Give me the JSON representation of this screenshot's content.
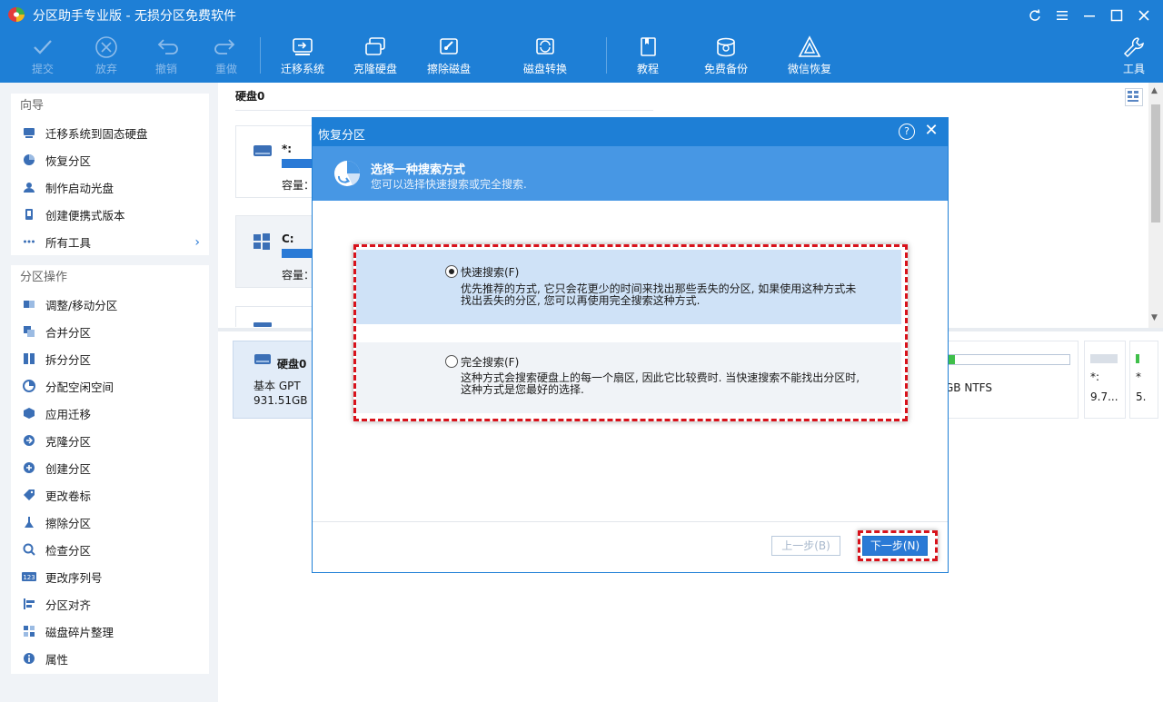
{
  "window": {
    "title": "分区助手专业版 - 无损分区免费软件",
    "controls": [
      "refresh-icon",
      "menu-icon",
      "minimize-icon",
      "maximize-icon",
      "close-icon"
    ]
  },
  "toolbar": {
    "commit": "提交",
    "discard": "放弃",
    "undo": "撤销",
    "redo": "重做",
    "migrate_os": "迁移系统",
    "clone_disk": "克隆硬盘",
    "wipe_disk": "擦除磁盘",
    "disk_convert": "磁盘转换",
    "tutorial": "教程",
    "free_backup": "免费备份",
    "wechat_recovery": "微信恢复",
    "tools": "工具"
  },
  "sidebar": {
    "wizard_header": "向导",
    "wizard_items": [
      {
        "label": "迁移系统到固态硬盘",
        "icon": "migrate-ssd-icon"
      },
      {
        "label": "恢复分区",
        "icon": "recover-partition-icon"
      },
      {
        "label": "制作启动光盘",
        "icon": "bootable-media-icon"
      },
      {
        "label": "创建便携式版本",
        "icon": "portable-version-icon"
      },
      {
        "label": "所有工具",
        "icon": "all-tools-icon"
      }
    ],
    "ops_header": "分区操作",
    "ops_items": [
      {
        "label": "调整/移动分区",
        "icon": "resize-partition-icon"
      },
      {
        "label": "合并分区",
        "icon": "merge-partition-icon"
      },
      {
        "label": "拆分分区",
        "icon": "split-partition-icon"
      },
      {
        "label": "分配空闲空间",
        "icon": "allocate-space-icon"
      },
      {
        "label": "应用迁移",
        "icon": "app-migrate-icon"
      },
      {
        "label": "克隆分区",
        "icon": "clone-partition-icon"
      },
      {
        "label": "创建分区",
        "icon": "create-partition-icon"
      },
      {
        "label": "更改卷标",
        "icon": "change-label-icon"
      },
      {
        "label": "擦除分区",
        "icon": "wipe-partition-icon"
      },
      {
        "label": "检查分区",
        "icon": "check-partition-icon"
      },
      {
        "label": "更改序列号",
        "icon": "change-serial-icon"
      },
      {
        "label": "分区对齐",
        "icon": "partition-align-icon"
      },
      {
        "label": "磁盘碎片整理",
        "icon": "defrag-icon"
      },
      {
        "label": "属性",
        "icon": "properties-icon"
      }
    ]
  },
  "main": {
    "disk_title": "硬盘0",
    "partitions": [
      {
        "name": "*:",
        "capacity_label": "容量："
      },
      {
        "name": "C:",
        "capacity_label": "容量："
      }
    ],
    "disk_summary": {
      "name": "硬盘0",
      "type": "基本 GPT",
      "size": "931.51GB"
    },
    "lower_fragments": {
      "ntfs_text": "GB NTFS",
      "p_star_1": "*:",
      "p_star_1_size": "9.7...",
      "p_star_2": "*",
      "p_star_2_size": "5."
    }
  },
  "dialog": {
    "title": "恢复分区",
    "header_title": "选择一种搜索方式",
    "header_subtitle": "您可以选择快速搜索或完全搜索.",
    "quick_label": "快速搜索(F)",
    "quick_desc": "优先推荐的方式, 它只会花更少的时间来找出那些丢失的分区, 如果使用这种方式未找出丢失的分区, 您可以再使用完全搜索这种方式.",
    "full_label": "完全搜索(F)",
    "full_desc": "这种方式会搜索硬盘上的每一个扇区, 因此它比较费时. 当快速搜索不能找出分区时, 这种方式是您最好的选择.",
    "prev_button": "上一步(B)",
    "next_button": "下一步(N)"
  },
  "colors": {
    "brand_blue": "#1e7fd6",
    "header_blue": "#4797e4",
    "highlight_red": "#d8121b"
  }
}
